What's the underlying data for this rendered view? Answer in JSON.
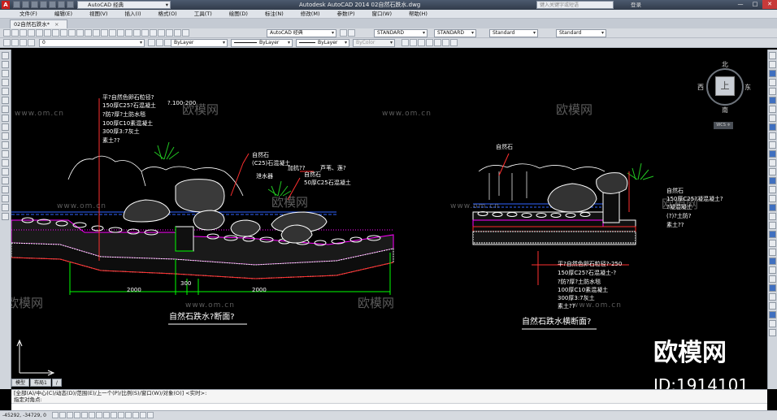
{
  "titlebar": {
    "logo_letter": "A",
    "workspace": "AutoCAD 经典",
    "app_title": "Autodesk AutoCAD 2014    02自然石跌水.dwg",
    "search_placeholder": "键入关键字或短语",
    "login": "登录",
    "btn_min": "—",
    "btn_max": "□",
    "btn_close": "✕"
  },
  "menu": [
    "文件(F)",
    "编辑(E)",
    "视图(V)",
    "插入(I)",
    "格式(O)",
    "工具(T)",
    "绘图(D)",
    "标注(N)",
    "修改(M)",
    "参数(P)",
    "窗口(W)",
    "帮助(H)"
  ],
  "filetab": {
    "label": "02自然石跌水*",
    "close": "×"
  },
  "toolbar1": {
    "workspace_combo": "AutoCAD 经典",
    "textstyle": "STANDARD",
    "dimstyle": "STANDARD",
    "tablestyle": "Standard",
    "mleaderstyle": "Standard"
  },
  "toolbar2": {
    "layer": "0",
    "color": "ByLayer",
    "linetype": "ByLayer",
    "lineweight": "ByLayer",
    "plotstyle": "ByColor"
  },
  "viewcube": {
    "north": "北",
    "south": "南",
    "east": "东",
    "west": "西",
    "face": "上",
    "wcs": "WCS ≑"
  },
  "drawing": {
    "left_section": {
      "title": "自然石跌水?断面?",
      "notes": [
        "平?自然色卵石粒径?",
        "150厚C25?石混凝土",
        "?防?厚?土防水毯",
        "100厚C10素混凝土",
        "300厚3:7灰土",
        "素土??"
      ],
      "note_suffix": "?.100-200",
      "labels": {
        "natural_stone": "自然石",
        "mortar": "(C25)石混凝土",
        "aquatic": "加抗??",
        "reed": "芦苇、莲?",
        "waterproof": "泄水器",
        "stone2": "自然石",
        "concrete": "50厚C25石混凝土"
      },
      "dims": [
        "2000",
        "300",
        "2000"
      ]
    },
    "right_section": {
      "title": "自然石跌水横断面?",
      "stone_label": "自然石",
      "right_notes": [
        "自然石",
        "150厚C25?凝混凝土?",
        "?凝混凝土",
        "(?)?土防?",
        "素土??"
      ],
      "notes": [
        "平?自然色卵石粒径?-250",
        "150厚C25?石混凝土-?",
        "?防?厚?土防水毯",
        "100厚C10素混凝土",
        "300厚3:7灰土",
        "素土??"
      ]
    }
  },
  "watermarks": {
    "brand": "欧模网",
    "url": "www.om.cn",
    "id": "ID:1914101"
  },
  "layout_tabs": [
    "模型",
    "布局1",
    "/"
  ],
  "command": {
    "line1": "[全部(A)/中心(C)/动态(D)/范围(E)/上一个(P)/比例(S)/窗口(W)/对象(O)] <实时>:",
    "line2": "指定对角点:",
    "prompt": ""
  },
  "status": {
    "coords": "-45292, -34729, 0"
  },
  "colors": {
    "canvas": "#000000",
    "section_line": "#ff2a2a",
    "hatch": "#ff00ff",
    "dimension": "#00ff00",
    "water": "#2f63ff",
    "plant": "#22c822",
    "leader": "#ff3030"
  }
}
